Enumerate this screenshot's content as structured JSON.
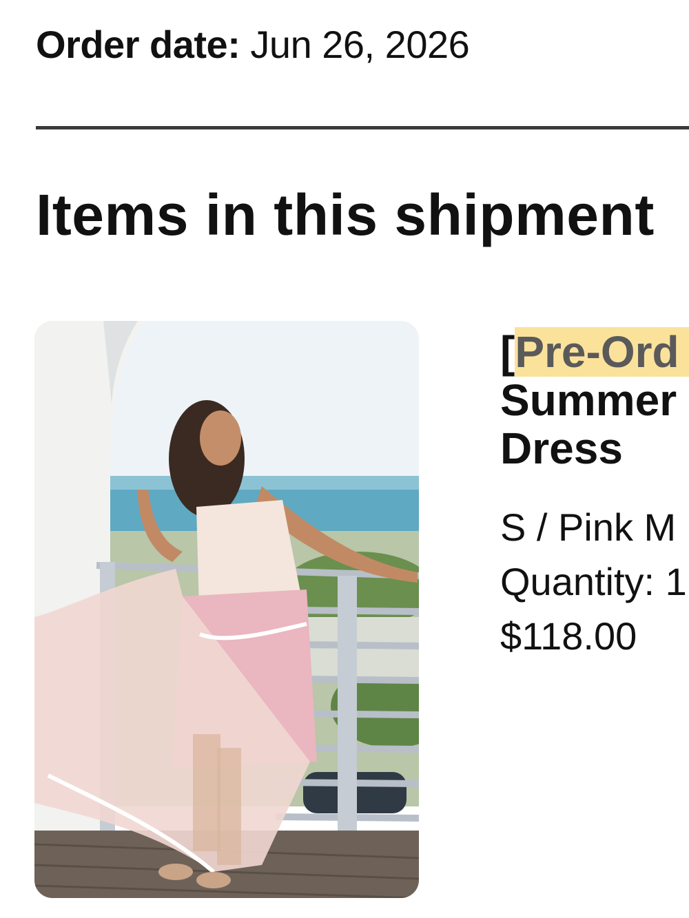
{
  "order": {
    "date_label": "Order date:",
    "date_value": "Jun 26, 2026"
  },
  "shipment": {
    "title": "Items in this shipment"
  },
  "item": {
    "title_bracket": "[",
    "title_tag": "Pre-Ord",
    "title_line2": "Summer",
    "title_line3": "Dress",
    "variant": "S / Pink M",
    "quantity": "Quantity: 1",
    "price": "$118.00",
    "image_name": "product-photo-pink-lace-maxi-dress"
  },
  "colors": {
    "divider": "#3a3a3a",
    "tag_highlight": "#fbe29b",
    "tag_text": "#5a5a5a"
  }
}
